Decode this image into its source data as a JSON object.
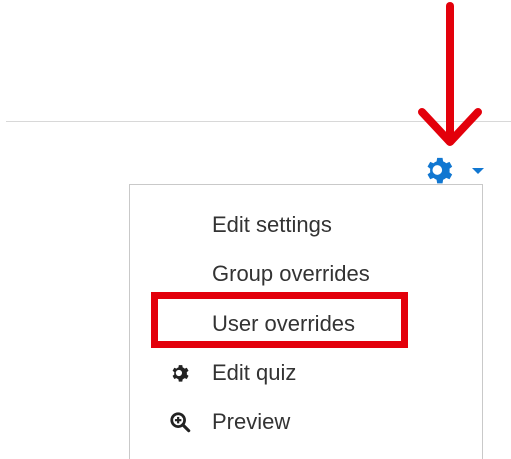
{
  "menu": {
    "items": [
      {
        "label": "Edit settings",
        "icon": null
      },
      {
        "label": "Group overrides",
        "icon": null
      },
      {
        "label": "User overrides",
        "icon": null,
        "highlighted": true
      },
      {
        "label": "Edit quiz",
        "icon": "gear-icon"
      },
      {
        "label": "Preview",
        "icon": "zoom-in-icon"
      }
    ]
  },
  "toggle": {
    "icon": "gear-icon",
    "caret_icon": "caret-down-icon"
  },
  "annotations": {
    "arrow_icon": "down-arrow-icon",
    "highlight_target": "User overrides"
  },
  "colors": {
    "gear_blue": "#1177d1",
    "annotation_red": "#e3000b",
    "menu_text": "#333333",
    "menu_border": "#c9c9c9",
    "divider": "#d8d8d8"
  }
}
